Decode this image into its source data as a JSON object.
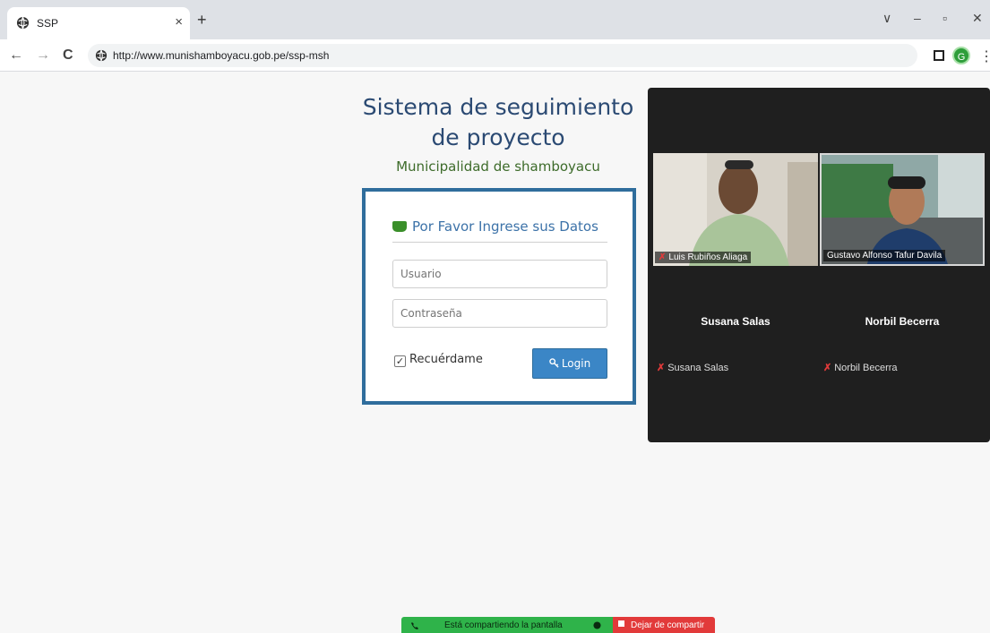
{
  "browser": {
    "tab_title": "SSP",
    "tab_close": "×",
    "new_tab": "+",
    "url": "http://www.munishamboyacu.gob.pe/ssp-msh",
    "profile_initial": "G",
    "window_controls": [
      "∨",
      "–",
      "▫",
      "✕"
    ],
    "nav": {
      "back": "←",
      "forward": "→",
      "reload": "C"
    },
    "menu": "⋮"
  },
  "page": {
    "title_line1": "Sistema de seguimiento",
    "title_line2": "de proyecto",
    "subtitle": "Municipalidad de shamboyacu",
    "panel_title": "Por Favor Ingrese sus Datos",
    "username_placeholder": "Usuario",
    "password_placeholder": "Contraseña",
    "remember_label": "Recuérdame",
    "remember_checked": "✓",
    "login_label": "Login"
  },
  "meeting": {
    "participants": [
      {
        "label": "Luis Rubiños Aliaga",
        "video": true,
        "muted": true
      },
      {
        "label": "Gustavo Alfonso Tafur Davila",
        "video": true,
        "muted": false
      },
      {
        "name": "Susana Salas",
        "label": "Susana Salas",
        "video": false,
        "muted": true
      },
      {
        "name": "Norbil Becerra",
        "label": "Norbil Becerra",
        "video": false,
        "muted": true
      }
    ],
    "mic_off_glyph": "✗",
    "share_status": "Está compartiendo la pantalla",
    "stop_share": "Dejar de compartir"
  },
  "colors": {
    "title_blue": "#2b4a73",
    "subtitle_green": "#3d6b2a",
    "login_border": "#2f6d9c",
    "login_button": "#3b86c6",
    "share_green": "#2fb34a",
    "share_red": "#e23a3a"
  }
}
